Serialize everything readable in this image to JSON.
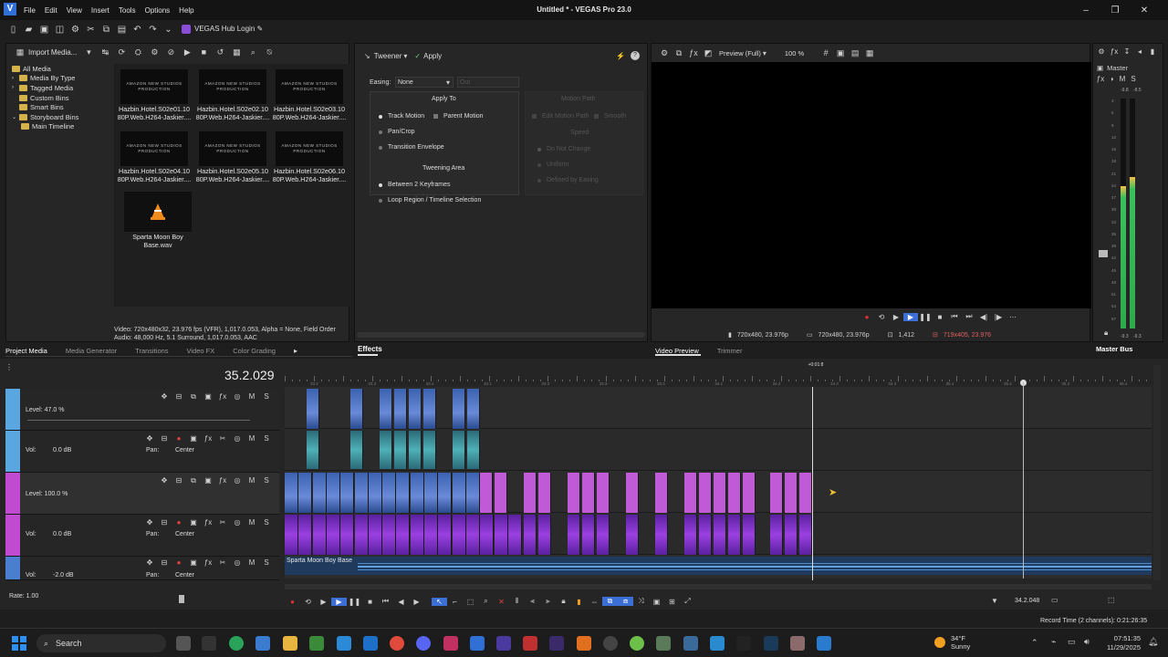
{
  "window": {
    "title": "Untitled * - VEGAS Pro 23.0",
    "menu": [
      "File",
      "Edit",
      "View",
      "Insert",
      "Tools",
      "Options",
      "Help"
    ],
    "hub_label": "VEGAS Hub Login",
    "logo_letter": "V"
  },
  "project_media": {
    "import_label": "Import Media...",
    "tree": [
      "All Media",
      "Media By Type",
      "Tagged Media",
      "Custom Bins",
      "Smart Bins",
      "Storyboard Bins",
      "Main Timeline"
    ],
    "thumb_text": [
      "AMAZON NEW STUDIOS",
      "PRODUCTION"
    ],
    "files": [
      {
        "line1": "Hazbin.Hotel.S02e01.10",
        "line2": "80P.Web.H264-Jaskier...."
      },
      {
        "line1": "Hazbin.Hotel.S02e02.10",
        "line2": "80P.Web.H264-Jaskier...."
      },
      {
        "line1": "Hazbin.Hotel.S02e03.10",
        "line2": "80P.Web.H264-Jaskier...."
      },
      {
        "line1": "Hazbin.Hotel.S02e04.10",
        "line2": "80P.Web.H264-Jaskier...."
      },
      {
        "line1": "Hazbin.Hotel.S02e05.10",
        "line2": "80P.Web.H264-Jaskier...."
      },
      {
        "line1": "Hazbin.Hotel.S02e06.10",
        "line2": "80P.Web.H264-Jaskier...."
      },
      {
        "line1": "Sparta Moon Boy",
        "line2": "Base.wav"
      }
    ],
    "info_line1": "Video: 720x480x32, 23.976 fps (VFR), 1,017.0.053, Alpha = None, Field Order",
    "info_line2": "Audio: 48,000 Hz, 5.1 Surround, 1,017.0.053, AAC",
    "tabs": [
      "Project Media",
      "Media Generator",
      "Transitions",
      "Video FX",
      "Color Grading"
    ]
  },
  "effects": {
    "tweener_label": "Tweener",
    "apply_label": "Apply",
    "easing_label": "Easing:",
    "easing_value": "None",
    "out_value": "Out",
    "apply_to_title": "Apply To",
    "apply_to": [
      "Track Motion",
      "Parent Motion",
      "Pan/Crop",
      "Transition Envelope"
    ],
    "motion_path_title": "Motion Path",
    "motion_path": [
      "Edit Motion Path",
      "Smooth"
    ],
    "speed_title": "Speed",
    "speed": [
      "Do Not Change",
      "Uniform",
      "Defined by Easing"
    ],
    "tweening_area_title": "Tweening Area",
    "tweening_area": [
      "Between 2 Keyframes",
      "Loop Region / Timeline Selection"
    ],
    "tab": "Effects"
  },
  "preview": {
    "mode": "Preview (Full)",
    "zoom": "100 %",
    "project_res": "720x480, 23.976p",
    "preview_res": "720x480, 23.976p",
    "frame": "1,412",
    "display": "719x405, 23.976",
    "tabs": [
      "Video Preview",
      "Trimmer"
    ]
  },
  "master": {
    "label": "Master",
    "peak_left": "-9.8",
    "peak_right": "-8.5",
    "bottom_left": "-9.3",
    "bottom_right": "-9.3",
    "scale": [
      "3",
      "6",
      "9",
      "12",
      "15",
      "18",
      "21",
      "24",
      "27",
      "30",
      "33",
      "36",
      "39",
      "42",
      "45",
      "48",
      "51",
      "54",
      "57"
    ],
    "tab": "Master Bus",
    "level_left": 0.62,
    "level_right": 0.66
  },
  "timeline": {
    "timecode": "35.2.029",
    "region_label": "+0:01:8",
    "tracks": [
      {
        "type": "video",
        "level_label": "Level: 47.0 %",
        "color": "#5aa6e0"
      },
      {
        "type": "audio",
        "vol_label": "Vol:",
        "vol": "0.0 dB",
        "pan_label": "Pan:",
        "pan": "Center",
        "color": "#5aa6e0"
      },
      {
        "type": "video",
        "level_label": "Level: 100.0 %",
        "color": "#c04bd0"
      },
      {
        "type": "audio",
        "vol_label": "Vol:",
        "vol": "0.0 dB",
        "pan_label": "Pan:",
        "pan": "Center",
        "color": "#c04bd0"
      },
      {
        "type": "audio",
        "vol_label": "Vol:",
        "vol": "-2.0 dB",
        "pan_label": "Pan:",
        "pan": "Center",
        "color": "#4a7fd0"
      }
    ],
    "audio_clip_label": "Sparta Moon Boy Base",
    "ruler_ticks": [
      "33.2",
      "33.3",
      "33.4",
      "33.1",
      "33.2",
      "33.3",
      "33.4",
      "34.1",
      "34.2",
      "34.3",
      "34.4",
      "35.1",
      "35.2",
      "35.3",
      "35.4"
    ],
    "rate_label": "Rate: 1.00",
    "selection_time": "34.2.048",
    "record_time": "Record Time (2 channels): 0:21:26:35"
  },
  "taskbar": {
    "search": "Search",
    "weather_temp": "34°F",
    "weather_desc": "Sunny",
    "time": "07:51:35",
    "date": "11/29/2025"
  }
}
